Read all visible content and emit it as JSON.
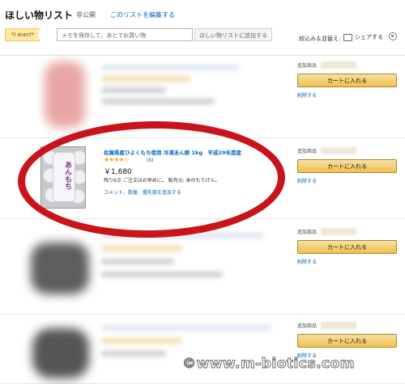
{
  "header": {
    "title": "ほしい物リスト",
    "privacy": "非公開",
    "edit_link": "このリストを編集する",
    "badge": "*I want*",
    "memo_placeholder": "メモを保存して、あとでお買い物",
    "add_to_list": "ほしい物リストに追加する",
    "filter_sort": "絞込み＆並替え:",
    "share": "シェアする"
  },
  "items": [
    {
      "added_label": "追加商品",
      "cart_label": "カートに入れる",
      "delete_label": "削除する"
    },
    {
      "added_label": "追加商品",
      "cart_label": "カートに入れる",
      "delete_label": "削除する",
      "title": "佐賀県産ひよくもち使用 冷凍あん餅 1kg　平成29年度産",
      "stars": "★★★★☆",
      "rating_count": "(6)",
      "price": "￥1,680",
      "stock": "残り6点 ご注文はお早めに。 販売元: 米のもりげん。",
      "comment_link": "コメント、数量、優先度を追加する",
      "package_text": "あんもち"
    },
    {
      "added_label": "追加商品",
      "cart_label": "カートに入れる",
      "delete_label": "削除する"
    },
    {
      "added_label": "追加商品",
      "cart_label": "カートに入れる",
      "delete_label": "削除する"
    }
  ],
  "watermark": "©www.m-biotics.com",
  "colors": {
    "link": "#0066c0",
    "cart_button": "#f0c14b",
    "highlight": "#c8141a"
  }
}
